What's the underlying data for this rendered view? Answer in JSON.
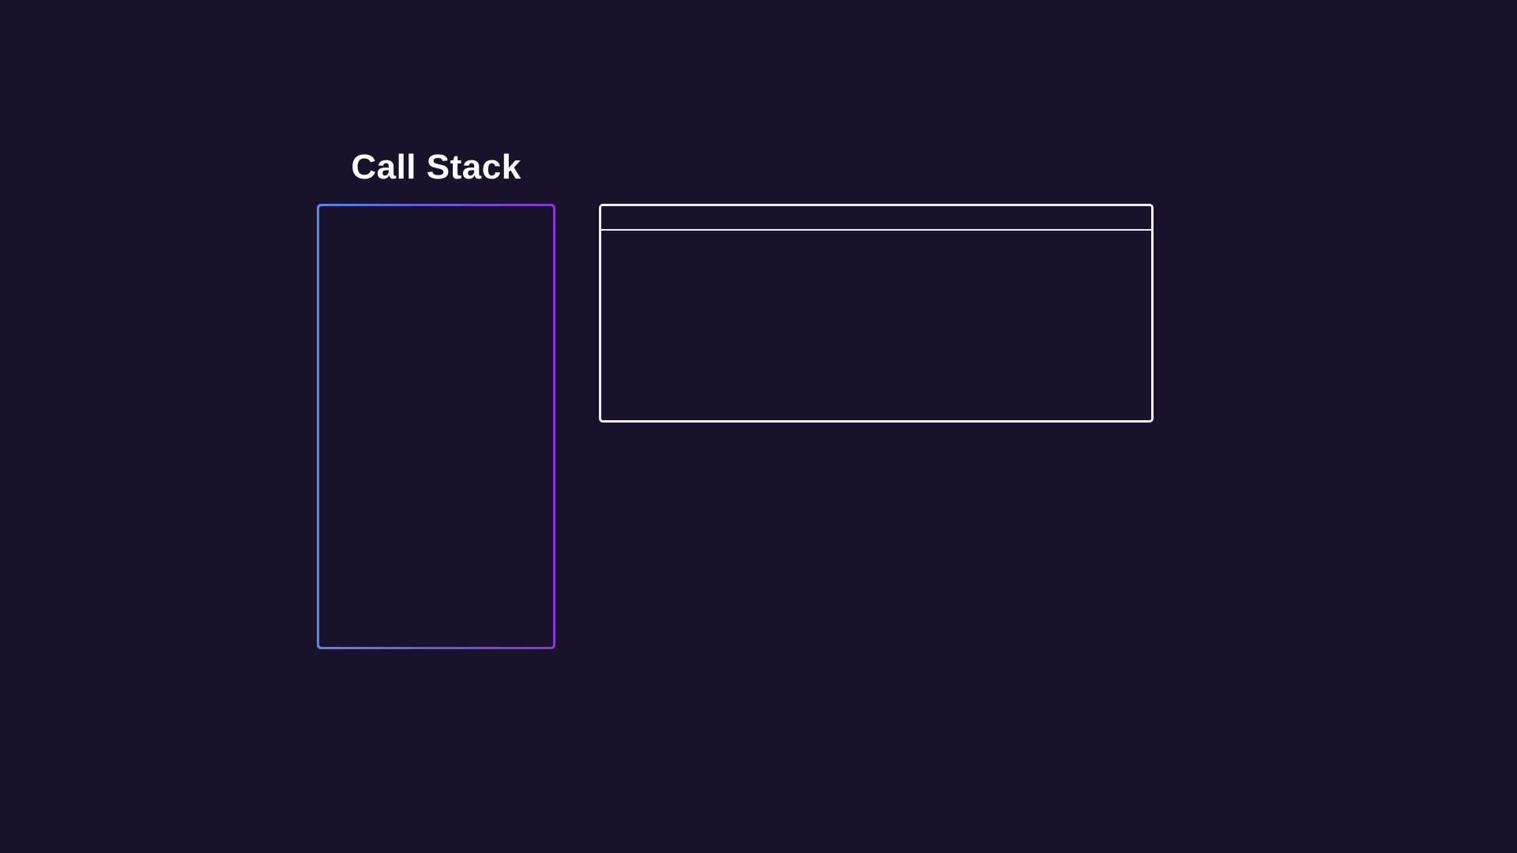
{
  "title": "Call Stack",
  "colors": {
    "background": "#18122b",
    "text": "#ffffff",
    "stack_border_gradient_start": "#4f8cf0",
    "stack_border_gradient_end": "#8a35d6",
    "panel_border": "#f0eef4"
  }
}
